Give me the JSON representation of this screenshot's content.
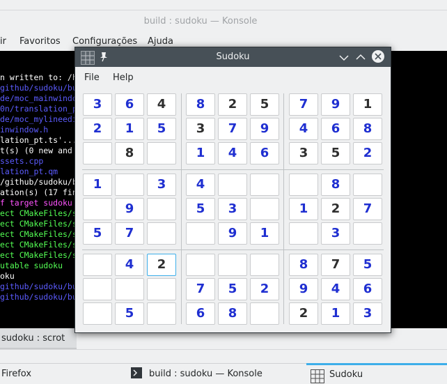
{
  "konsole": {
    "title": "build : sudoku — Konsole",
    "menu": [
      "ir",
      "Favoritos",
      "Configurações",
      "Ajuda"
    ],
    "terminal_lines": [
      {
        "text": "n written to: /h",
        "color": "#ffffff"
      },
      {
        "text": "github/sudoku/bu",
        "color": "#5c5cff"
      },
      {
        "text": "de/moc_mainwindo",
        "color": "#5c5cff"
      },
      {
        "text": "0n/translation_p",
        "color": "#5c5cff"
      },
      {
        "text": "de/moc_mylineedi",
        "color": "#5c5cff"
      },
      {
        "text": "inwindow.h",
        "color": "#5c5cff"
      },
      {
        "text": "lation_pt.ts'...",
        "color": "#ffffff"
      },
      {
        "text": "t(s) (0 new and",
        "color": "#ffffff"
      },
      {
        "text": "ssets.cpp",
        "color": "#5c5cff"
      },
      {
        "text": "lation_pt.qm",
        "color": "#5c5cff"
      },
      {
        "text": "/github/sudoku/b",
        "color": "#ffffff"
      },
      {
        "text": "ation(s) (17 fin",
        "color": "#ffffff"
      },
      {
        "text": "f target sudoku",
        "color": "#ff54ff"
      },
      {
        "text": "ect CMakeFiles/s",
        "color": "#54ff54"
      },
      {
        "text": "ect CMakeFiles/s",
        "color": "#54ff54"
      },
      {
        "text": "ect CMakeFiles/s",
        "color": "#54ff54"
      },
      {
        "text": "ect CMakeFiles/s",
        "color": "#54ff54"
      },
      {
        "text": "ect CMakeFiles/s",
        "color": "#54ff54"
      },
      {
        "text": "utable sudoku",
        "color": "#54ff54"
      },
      {
        "text": "oku",
        "color": "#ffffff"
      },
      {
        "text": "github/sudoku/bu",
        "color": "#5c5cff"
      },
      {
        "text": "github/sudoku/bu",
        "color": "#5c5cff"
      }
    ],
    "tab_label": "sudoku : scrot"
  },
  "taskbar": {
    "items": [
      {
        "label": "Firefox"
      },
      {
        "label": "build : sudoku — Konsole"
      },
      {
        "label": "Sudoku"
      }
    ]
  },
  "sudoku": {
    "title": "Sudoku",
    "menu": {
      "file": "File",
      "help": "Help"
    },
    "accent": "#3daee9",
    "user_color": "#1f2fd1",
    "given_color": "#2e2e2e",
    "grid": [
      [
        "3u",
        "6u",
        "4g",
        "8u",
        "2g",
        "5g",
        "7u",
        "9u",
        "1g"
      ],
      [
        "2u",
        "1u",
        "5u",
        "3g",
        "7u",
        "9u",
        "4u",
        "6u",
        "8u"
      ],
      [
        "",
        "8g",
        "",
        "1u",
        "4u",
        "6u",
        "3g",
        "5g",
        "2u"
      ],
      [
        "1u",
        "",
        "3u",
        "4u",
        "",
        "",
        "",
        "8u",
        ""
      ],
      [
        "",
        "9u",
        "",
        "5u",
        "3u",
        "",
        "1u",
        "2g",
        "7u"
      ],
      [
        "5u",
        "7u",
        "",
        "",
        "9u",
        "1u",
        "",
        "3u",
        ""
      ],
      [
        "",
        "4u",
        "2g",
        "",
        "",
        "",
        "8u",
        "7g",
        "5u"
      ],
      [
        "",
        "",
        "",
        "7u",
        "5u",
        "2u",
        "9u",
        "4u",
        "6u"
      ],
      [
        "",
        "5u",
        "",
        "6u",
        "8u",
        "",
        "2g",
        "1u",
        "3u"
      ]
    ],
    "selected_cell": "r6c2"
  }
}
